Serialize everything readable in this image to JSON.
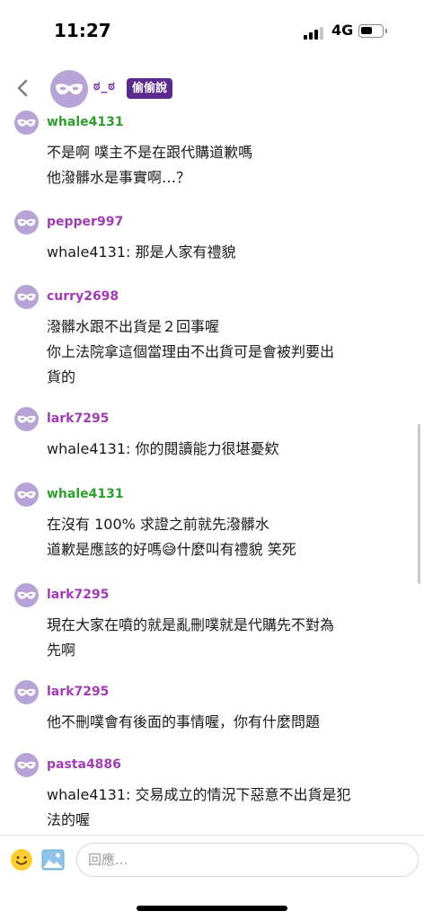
{
  "status_bar": {
    "time": "11:27",
    "network": "4G"
  },
  "header": {
    "name": "ಠ_ಠ",
    "badge": "偷偷說"
  },
  "colors": {
    "mask_bg": "#b7a3d6",
    "badge_bg": "#5a2a8f",
    "green_user": "#2e9e2e",
    "purple_user": "#a23cb3"
  },
  "comments": [
    {
      "username": "whale4131",
      "color": "#2e9e2e",
      "lines": [
        "不是啊 噗主不是在跟代購道歉嗎",
        "他潑髒水是事實啊…？"
      ]
    },
    {
      "username": "pepper997",
      "color": "#a23cb3",
      "lines": [
        "whale4131: 那是人家有禮貌"
      ]
    },
    {
      "username": "curry2698",
      "color": "#a23cb3",
      "lines": [
        "潑髒水跟不出貨是２回事喔",
        "你上法院拿這個當理由不出貨可是會被判要出",
        "貨的"
      ]
    },
    {
      "username": "lark7295",
      "color": "#a23cb3",
      "lines": [
        "whale4131: 你的閱讀能力很堪憂欸"
      ]
    },
    {
      "username": "whale4131",
      "color": "#2e9e2e",
      "lines": [
        "在沒有 100% 求證之前就先潑髒水",
        "道歉是應該的好嗎😅什麼叫有禮貌 笑死"
      ]
    },
    {
      "username": "lark7295",
      "color": "#a23cb3",
      "lines": [
        "現在大家在噴的就是亂刪噗就是代購先不對為",
        "先啊"
      ]
    },
    {
      "username": "lark7295",
      "color": "#a23cb3",
      "lines": [
        "他不刪噗會有後面的事情喔，你有什麼問題"
      ]
    },
    {
      "username": "pasta4886",
      "color": "#a23cb3",
      "lines": [
        "whale4131: 交易成立的情況下惡意不出貨是犯",
        "法的喔"
      ]
    }
  ],
  "reply": {
    "placeholder": "回應..."
  }
}
